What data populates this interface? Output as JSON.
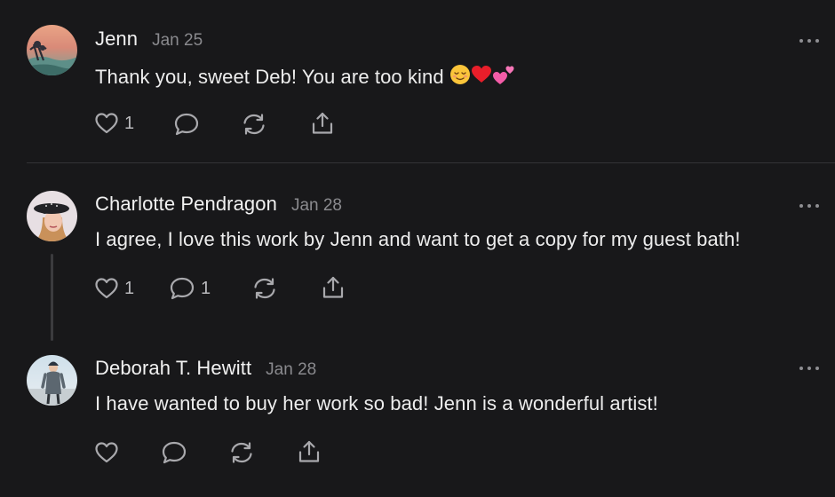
{
  "comments": [
    {
      "author": "Jenn",
      "date": "Jan 25",
      "text": "Thank you, sweet Deb! You are too kind",
      "emojis": [
        "relieved-face",
        "red-heart",
        "two-hearts"
      ],
      "likes": "1",
      "replies": ""
    },
    {
      "author": "Charlotte Pendragon",
      "date": "Jan 28",
      "text": "I agree, I love this work by Jenn and want to get a copy for my guest bath!",
      "likes": "1",
      "replies": "1"
    },
    {
      "author": "Deborah T. Hewitt",
      "date": "Jan 28",
      "text": "I have wanted to buy her work so bad! Jenn is a wonderful artist!",
      "likes": "",
      "replies": ""
    }
  ],
  "icons": {
    "like": "heart-icon",
    "reply": "comment-icon",
    "restack": "restack-icon",
    "share": "share-icon",
    "more": "more-icon"
  },
  "colors": {
    "background": "#18181a",
    "text": "#ededed",
    "muted": "#8a8a8e",
    "icon": "#a9a9ad",
    "divider": "#343437"
  }
}
